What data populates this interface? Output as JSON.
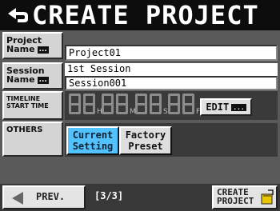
{
  "header": {
    "title": "CREATE PROJECT",
    "back_icon": "return-arrow-icon"
  },
  "project_name": {
    "label_line1": "Project",
    "label_line2": "Name",
    "edit_dots": "...",
    "value": "Project01"
  },
  "session_name": {
    "label_line1": "Session",
    "label_line2": "Name",
    "edit_dots": "...",
    "value_line1": "1st Session",
    "value_line2": "Session001"
  },
  "timeline": {
    "label_line1": "TIMELINE",
    "label_line2": "START TIME",
    "separators": [
      "H",
      "M",
      "S",
      "F"
    ],
    "edit_label": "EDIT",
    "edit_dots": "..."
  },
  "others": {
    "label": "OTHERS",
    "options": [
      {
        "line1": "Current",
        "line2": "Setting",
        "selected": true
      },
      {
        "line1": "Factory",
        "line2": "Preset",
        "selected": false
      }
    ]
  },
  "footer": {
    "prev_label": "PREV.",
    "page": "[3/3]",
    "create_line1": "CREATE",
    "create_line2": "PROJECT"
  },
  "colors": {
    "selected": "#52c2ff",
    "title_bg": "#0d0d0d",
    "panel_bg": "#5a5a5a"
  }
}
